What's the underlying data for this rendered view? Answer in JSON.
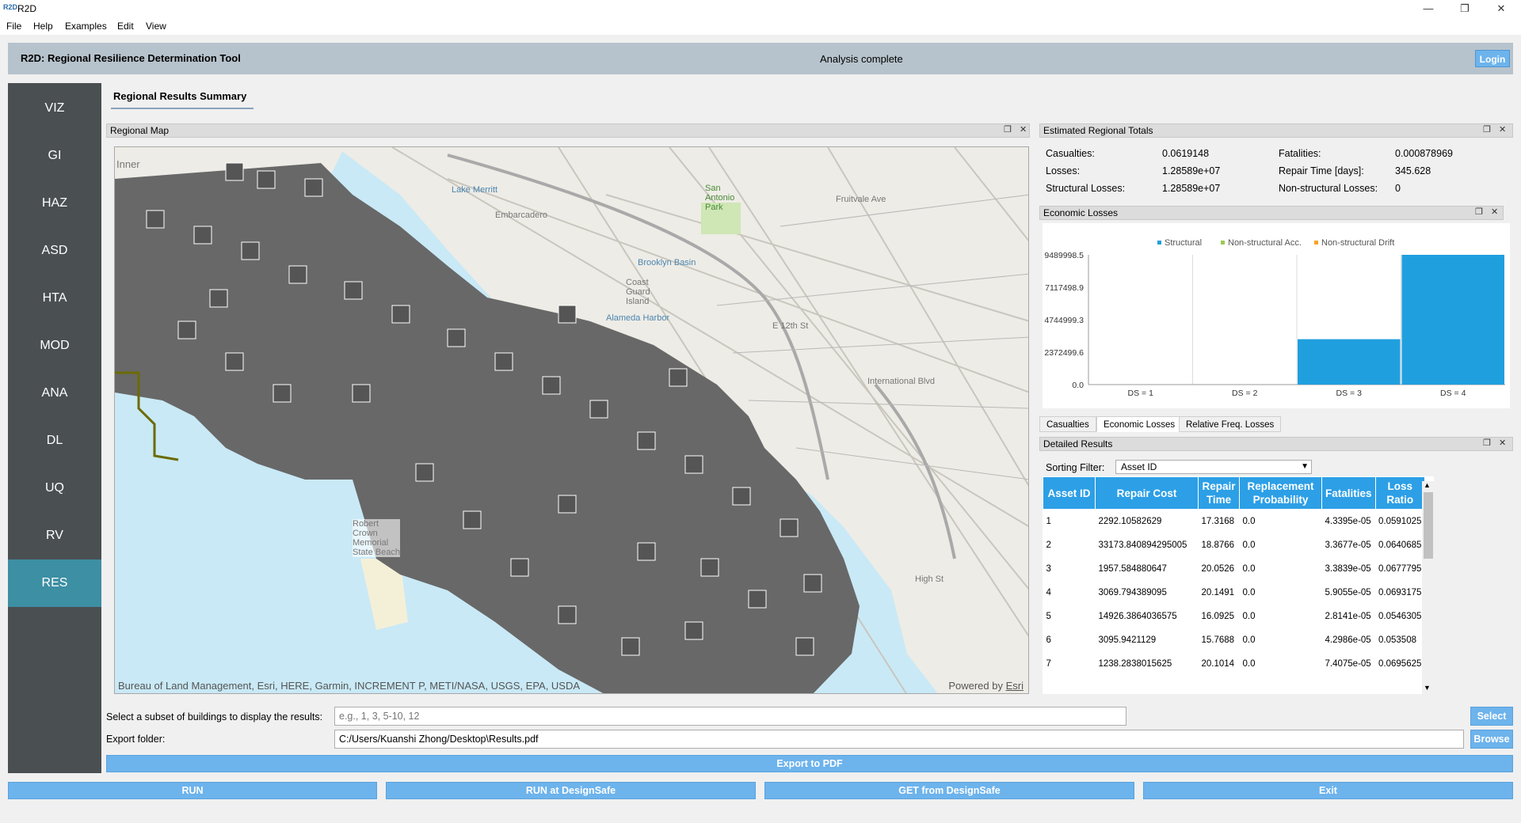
{
  "window": {
    "app_icon": "R2D",
    "title": "R2D",
    "minimize": "—",
    "restore": "❐",
    "close": "✕"
  },
  "menu": [
    "File",
    "Help",
    "Examples",
    "Edit",
    "View"
  ],
  "header": {
    "title": "R2D: Regional Resilience Determination Tool",
    "status": "Analysis complete",
    "login": "Login"
  },
  "sidebar": [
    "VIZ",
    "GI",
    "HAZ",
    "ASD",
    "HTA",
    "MOD",
    "ANA",
    "DL",
    "UQ",
    "RV",
    "RES"
  ],
  "sidebar_active": "RES",
  "results_tab": "Regional Results Summary",
  "map": {
    "panel_title": "Regional Map",
    "attribution": "Bureau of Land Management, Esri, HERE, Garmin, INCREMENT P, METI/NASA, USGS, EPA, USDA",
    "powered_by": "Powered by",
    "esri": "Esri",
    "labels": [
      "Lake Merritt",
      "San Antonio Park",
      "Coast Guard Island",
      "Brooklyn Basin",
      "Alameda Harbor",
      "International Blvd",
      "E 12th St",
      "Fruitvale Ave",
      "Robert Crown Memorial State Beach",
      "Embarcadero",
      "Inner",
      "High St"
    ]
  },
  "totals": {
    "panel_title": "Estimated Regional Totals",
    "rows": [
      {
        "label1": "Casualties:",
        "value1": "0.0619148",
        "label2": "Fatalities:",
        "value2": "0.000878969"
      },
      {
        "label1": "Losses:",
        "value1": "1.28589e+07",
        "label2": "Repair Time [days]:",
        "value2": "345.628"
      },
      {
        "label1": "Structural Losses:",
        "value1": "1.28589e+07",
        "label2": "Non-structural Losses:",
        "value2": "0"
      }
    ]
  },
  "losses_panel": {
    "title": "Economic Losses"
  },
  "chart_data": {
    "type": "bar",
    "categories": [
      "DS = 1",
      "DS = 2",
      "DS = 3",
      "DS = 4"
    ],
    "series": [
      {
        "name": "Structural",
        "color": "#209fdf",
        "values": [
          0,
          0,
          3320000,
          9489998.5
        ]
      },
      {
        "name": "Non-structural Acc.",
        "color": "#99ca53",
        "values": [
          0,
          0,
          0,
          0
        ]
      },
      {
        "name": "Non-structural Drift",
        "color": "#f6a625",
        "values": [
          0,
          0,
          0,
          0
        ]
      }
    ],
    "yticks": [
      "9489998.5",
      "7117498.9",
      "4744999.3",
      "2372499.6",
      "0.0"
    ],
    "ylim": [
      0,
      9489998.5
    ],
    "legend": "top"
  },
  "sub_tabs": [
    "Casualties",
    "Economic Losses",
    "Relative Freq. Losses"
  ],
  "sub_tab_active": "Economic Losses",
  "details": {
    "panel_title": "Detailed Results",
    "sort_label": "Sorting Filter:",
    "sort_value": "Asset ID",
    "columns": [
      "Asset ID",
      "Repair Cost",
      "Repair Time",
      "Replacement Probability",
      "Fatalities",
      "Loss Ratio"
    ],
    "rows": [
      [
        "1",
        "2292.10582629",
        "17.3168",
        "0.0",
        "4.3395e-05",
        "0.0591025"
      ],
      [
        "2",
        "33173.840894295005",
        "18.8766",
        "0.0",
        "3.3677e-05",
        "0.0640685"
      ],
      [
        "3",
        "1957.584880647",
        "20.0526",
        "0.0",
        "3.3839e-05",
        "0.0677795"
      ],
      [
        "4",
        "3069.794389095",
        "20.1491",
        "0.0",
        "5.9055e-05",
        "0.0693175"
      ],
      [
        "5",
        "14926.3864036575",
        "16.0925",
        "0.0",
        "2.8141e-05",
        "0.0546305"
      ],
      [
        "6",
        "3095.9421129",
        "15.7688",
        "0.0",
        "4.2986e-05",
        "0.053508"
      ],
      [
        "7",
        "1238.2838015625",
        "20.1014",
        "0.0",
        "7.4075e-05",
        "0.0695625"
      ]
    ]
  },
  "subset": {
    "label": "Select a subset of buildings to display the results:",
    "placeholder": "e.g., 1, 3, 5-10, 12",
    "button": "Select"
  },
  "export": {
    "label": "Export folder:",
    "value": "C:/Users/Kuanshi Zhong/Desktop\\Results.pdf",
    "browse": "Browse",
    "pdf_button": "Export to PDF"
  },
  "actions": [
    "RUN",
    "RUN at DesignSafe",
    "GET from DesignSafe",
    "Exit"
  ]
}
